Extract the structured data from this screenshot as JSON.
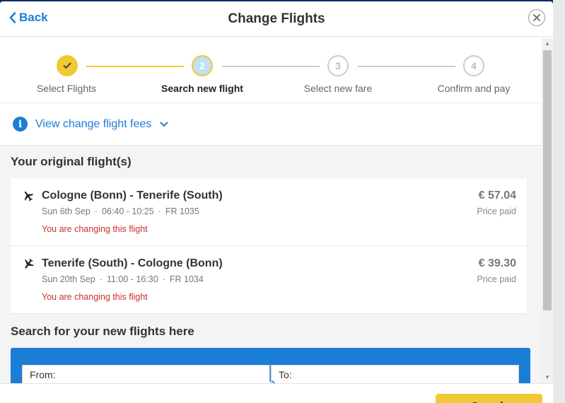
{
  "header": {
    "back_label": "Back",
    "title": "Change Flights"
  },
  "stepper": {
    "steps": [
      {
        "number": "1",
        "label": "Select Flights",
        "state": "done"
      },
      {
        "number": "2",
        "label": "Search new flight",
        "state": "active"
      },
      {
        "number": "3",
        "label": "Select new fare",
        "state": "todo"
      },
      {
        "number": "4",
        "label": "Confirm and pay",
        "state": "todo"
      }
    ]
  },
  "fees": {
    "info_glyph": "i",
    "label": "View change flight fees"
  },
  "original": {
    "heading": "Your original flight(s)",
    "flights": [
      {
        "route": "Cologne (Bonn) - Tenerife (South)",
        "date": "Sun 6th Sep",
        "time": "06:40 - 10:25",
        "flight_no": "FR 1035",
        "status": "You are changing this flight",
        "price": "€ 57.04",
        "price_label": "Price paid"
      },
      {
        "route": "Tenerife (South) - Cologne (Bonn)",
        "date": "Sun 20th Sep",
        "time": "11:00 - 16:30",
        "flight_no": "FR 1034",
        "status": "You are changing this flight",
        "price": "€ 39.30",
        "price_label": "Price paid"
      }
    ]
  },
  "search": {
    "heading": "Search for your new flights here",
    "from_label": "From:",
    "to_label": "To:",
    "button_label": "Search"
  },
  "colors": {
    "accent_blue": "#1a7ed6",
    "accent_yellow": "#f1c934",
    "warning_red": "#c9302c"
  }
}
